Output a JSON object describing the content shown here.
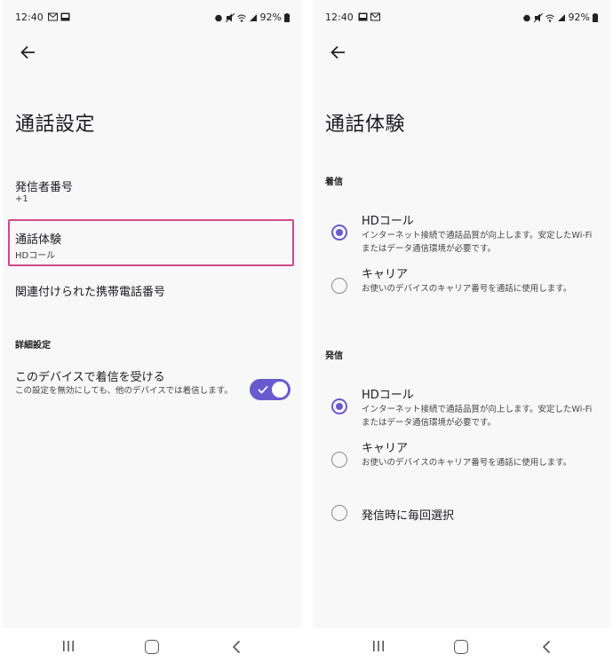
{
  "left": {
    "status": {
      "time": "12:40",
      "battery": "92%"
    },
    "title": "通話設定",
    "caller_number": {
      "label": "発信者番号",
      "value": "+1"
    },
    "call_experience": {
      "label": "通話体験",
      "value": "HDコール"
    },
    "linked_mobile": {
      "label": "関連付けられた携帯電話番号"
    },
    "advanced": {
      "label": "詳細設定"
    },
    "receive_on_device": {
      "label": "このデバイスで着信を受ける",
      "description": "この設定を無効にしても、他のデバイスでは着信します。",
      "enabled": true
    }
  },
  "right": {
    "status": {
      "time": "12:40",
      "battery": "92%"
    },
    "title": "通話体験",
    "incoming": {
      "label": "着信",
      "options": [
        {
          "title": "HDコール",
          "desc": "インターネット接続で通話品質が向上します。安定したWi-Fiまたはデータ通信環境が必要です。",
          "selected": true
        },
        {
          "title": "キャリア",
          "desc": "お使いのデバイスのキャリア番号を通話に使用します。",
          "selected": false
        }
      ]
    },
    "outgoing": {
      "label": "発信",
      "options": [
        {
          "title": "HDコール",
          "desc": "インターネット接続で通話品質が向上します。安定したWi-Fiまたはデータ通信環境が必要です。",
          "selected": true
        },
        {
          "title": "キャリア",
          "desc": "お使いのデバイスのキャリア番号を通話に使用します。",
          "selected": false
        },
        {
          "title": "発信時に毎回選択",
          "desc": "",
          "selected": false
        }
      ]
    }
  },
  "colors": {
    "accent": "#6a5acd",
    "highlight": "#cf4b86"
  },
  "icons": [
    "back-arrow-icon",
    "toggle-check-icon",
    "nav-recents-icon",
    "nav-home-icon",
    "nav-back-icon"
  ]
}
